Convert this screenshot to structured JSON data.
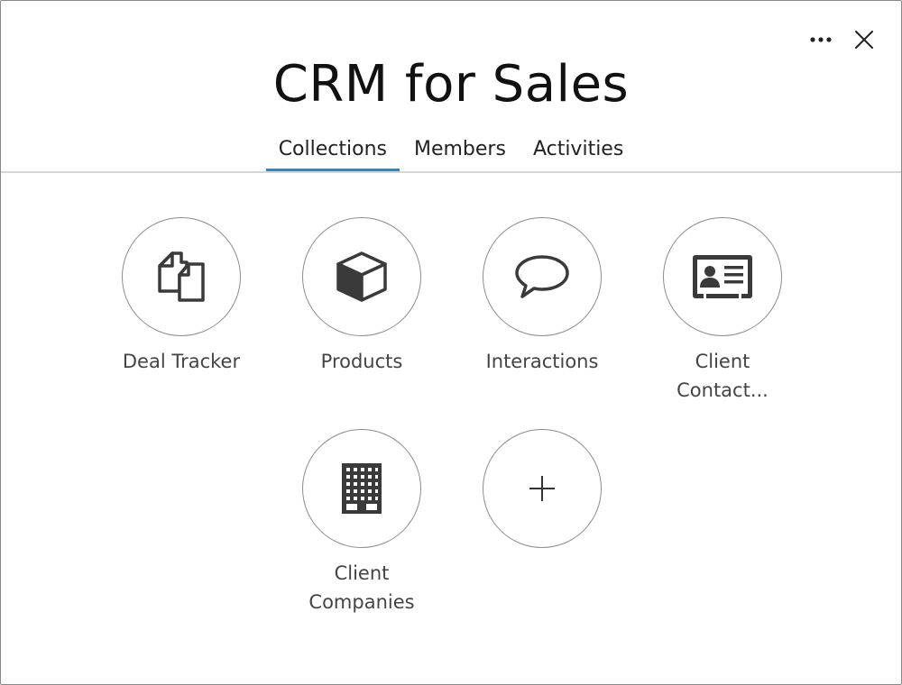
{
  "dialog": {
    "title": "CRM for Sales",
    "more_icon": "more-horizontal-icon",
    "close_icon": "close-icon"
  },
  "tabs": [
    {
      "label": "Collections",
      "active": true
    },
    {
      "label": "Members",
      "active": false
    },
    {
      "label": "Activities",
      "active": false
    }
  ],
  "collections": [
    {
      "label": "Deal Tracker",
      "icon": "copy-documents-icon"
    },
    {
      "label": "Products",
      "icon": "cube-icon"
    },
    {
      "label": "Interactions",
      "icon": "speech-bubble-icon"
    },
    {
      "label_line1": "Client",
      "label_line2": "Contact...",
      "icon": "contact-card-icon"
    },
    {
      "label_line1": "Client",
      "label_line2": "Companies",
      "icon": "building-icon"
    },
    {
      "label": "",
      "icon": "plus-icon"
    }
  ],
  "colors": {
    "accent": "#1f8ecf",
    "icon": "#3a3a3a"
  }
}
